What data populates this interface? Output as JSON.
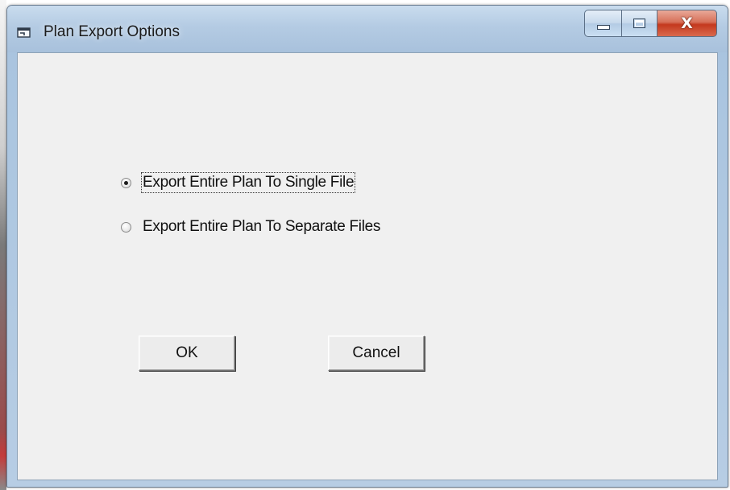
{
  "window": {
    "title": "Plan Export Options",
    "icon": "app-window-icon"
  },
  "caption_buttons": {
    "minimize_icon": "minimize-icon",
    "maximize_icon": "maximize-icon",
    "close_label": "X"
  },
  "options": [
    {
      "label": "Export Entire Plan To Single File",
      "checked": true
    },
    {
      "label": "Export Entire Plan To Separate Files",
      "checked": false
    }
  ],
  "buttons": {
    "ok": "OK",
    "cancel": "Cancel"
  }
}
